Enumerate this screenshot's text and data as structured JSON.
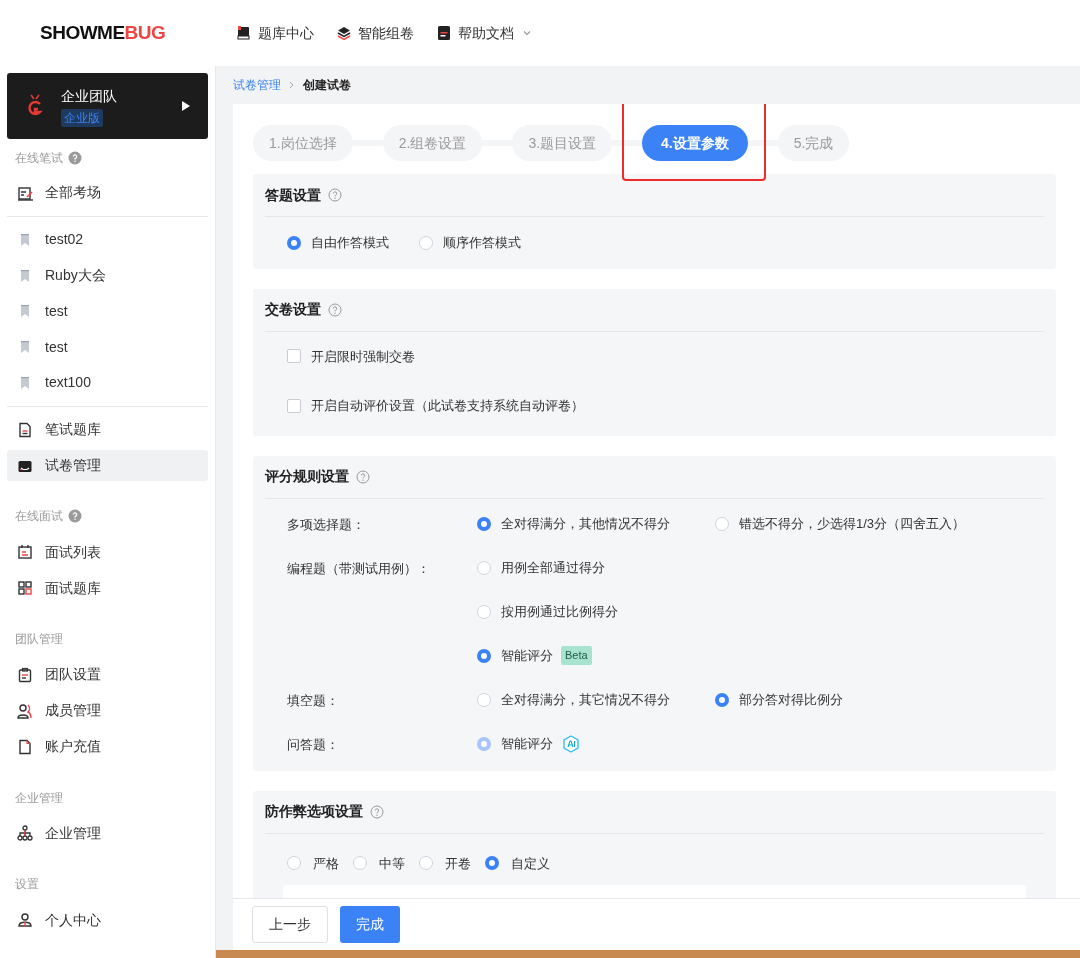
{
  "header": {
    "logo": {
      "dark": "SHOWME",
      "accent": "BUG"
    },
    "nav": [
      {
        "label": "题库中心",
        "dropdown": false
      },
      {
        "label": "智能组卷",
        "dropdown": false
      },
      {
        "label": "帮助文档",
        "dropdown": true
      }
    ]
  },
  "sidebar": {
    "team": {
      "name": "企业团队",
      "badge": "企业版"
    },
    "groups": [
      {
        "title": "在线笔试",
        "help": true,
        "items": [
          {
            "kind": "nav",
            "label": "全部考场",
            "selected": false
          },
          {
            "kind": "divider"
          },
          {
            "kind": "exam",
            "label": "test02",
            "selected": false
          },
          {
            "kind": "exam",
            "label": "Ruby大会",
            "selected": false
          },
          {
            "kind": "exam",
            "label": "test",
            "selected": false
          },
          {
            "kind": "exam",
            "label": "test",
            "selected": false
          },
          {
            "kind": "exam",
            "label": "text100",
            "selected": false
          },
          {
            "kind": "divider"
          },
          {
            "kind": "nav",
            "label": "笔试题库",
            "selected": false
          },
          {
            "kind": "nav",
            "label": "试卷管理",
            "selected": true
          }
        ]
      },
      {
        "title": "在线面试",
        "help": true,
        "items": [
          {
            "kind": "nav",
            "label": "面试列表",
            "selected": false
          },
          {
            "kind": "nav",
            "label": "面试题库",
            "selected": false
          }
        ]
      },
      {
        "title": "团队管理",
        "help": false,
        "items": [
          {
            "kind": "nav",
            "label": "团队设置",
            "selected": false
          },
          {
            "kind": "nav",
            "label": "成员管理",
            "selected": false
          },
          {
            "kind": "nav",
            "label": "账户充值",
            "selected": false
          }
        ]
      },
      {
        "title": "企业管理",
        "help": false,
        "items": [
          {
            "kind": "nav",
            "label": "企业管理",
            "selected": false
          }
        ]
      },
      {
        "title": "设置",
        "help": false,
        "items": [
          {
            "kind": "nav",
            "label": "个人中心",
            "selected": false
          }
        ]
      }
    ]
  },
  "breadcrumb": [
    {
      "label": "试卷管理",
      "link": true
    },
    {
      "label": "创建试卷",
      "link": false
    }
  ],
  "steps": [
    {
      "label": "1.岗位选择",
      "selected": false,
      "highlighted": false
    },
    {
      "label": "2.组卷设置",
      "selected": false,
      "highlighted": false
    },
    {
      "label": "3.题目设置",
      "selected": false,
      "highlighted": false
    },
    {
      "label": "4.设置参数",
      "selected": true,
      "highlighted": true
    },
    {
      "label": "5.完成",
      "selected": false,
      "highlighted": false
    }
  ],
  "sections": [
    {
      "kind": "radios",
      "title": "答题设置",
      "options": [
        {
          "label": "自由作答模式",
          "selected": true
        },
        {
          "label": "顺序作答模式",
          "selected": false
        }
      ]
    },
    {
      "kind": "checks",
      "title": "交卷设置",
      "options": [
        {
          "label": "开启限时强制交卷",
          "checked": false
        },
        {
          "label": "开启自动评价设置（此试卷支持系统自动评卷）",
          "checked": false
        }
      ]
    },
    {
      "kind": "rules",
      "title": "评分规则设置",
      "rows": [
        {
          "label": "多项选择题：",
          "options": [
            {
              "label": "全对得满分，其他情况不得分",
              "selected": true,
              "disabled": false
            },
            {
              "label": "错选不得分，少选得1/3分（四舍五入）",
              "selected": false,
              "disabled": false
            }
          ]
        },
        {
          "label": "编程题（带测试用例）：",
          "options": [
            {
              "label": "用例全部通过得分",
              "selected": false,
              "disabled": false
            }
          ]
        },
        {
          "options": [
            {
              "label": "按用例通过比例得分",
              "selected": false,
              "disabled": false
            }
          ]
        },
        {
          "options": [
            {
              "label": "智能评分",
              "selected": true,
              "disabled": false,
              "tag": "Beta"
            }
          ]
        },
        {
          "label": "填空题：",
          "options": [
            {
              "label": "全对得满分，其它情况不得分",
              "selected": false,
              "disabled": false
            },
            {
              "label": "部分答对得比例分",
              "selected": true,
              "disabled": false
            }
          ]
        },
        {
          "label": "问答题：",
          "options": [
            {
              "label": "智能评分",
              "selected": true,
              "disabled": true,
              "ai": true
            }
          ]
        }
      ]
    },
    {
      "kind": "anticheat",
      "title": "防作弊选项设置",
      "options": [
        {
          "label": "严格",
          "selected": false
        },
        {
          "label": "中等",
          "selected": false
        },
        {
          "label": "开卷",
          "selected": false
        },
        {
          "label": "自定义",
          "selected": true
        }
      ]
    }
  ],
  "footer": {
    "buttons": [
      {
        "label": "上一步",
        "primary": false
      },
      {
        "label": "完成",
        "primary": true
      }
    ]
  }
}
